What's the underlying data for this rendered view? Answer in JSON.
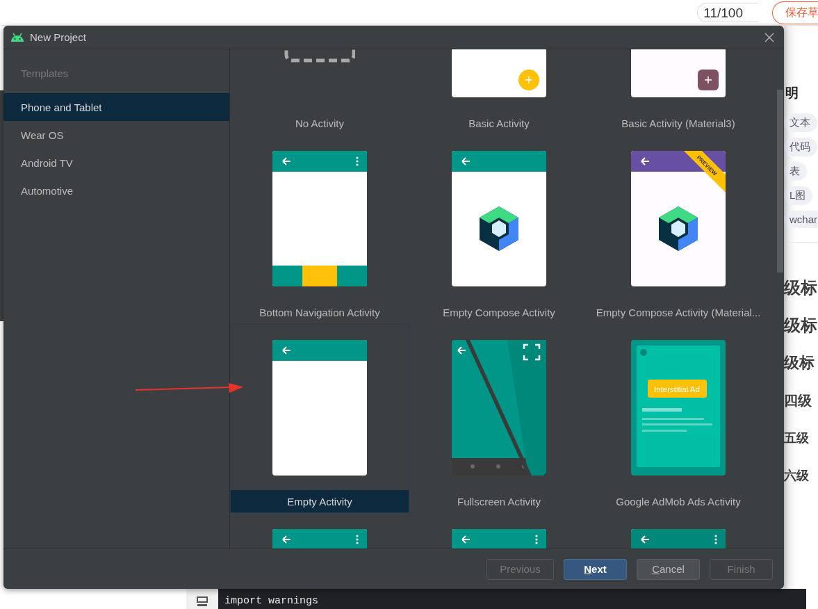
{
  "background_page": {
    "word_count": "11/100",
    "save_button": "保存草",
    "side_panel": {
      "heading": "明",
      "tags": [
        "文本",
        "代码",
        "表",
        "L图",
        "wchar"
      ],
      "headings": [
        "级标",
        "级标",
        "级标",
        "四级",
        "五级",
        "六级"
      ]
    },
    "code": "import warnings"
  },
  "window": {
    "title": "New Project"
  },
  "sidebar": {
    "header": "Templates",
    "items": [
      {
        "label": "Phone and Tablet",
        "selected": true
      },
      {
        "label": "Wear OS",
        "selected": false
      },
      {
        "label": "Android TV",
        "selected": false
      },
      {
        "label": "Automotive",
        "selected": false
      }
    ]
  },
  "templates": [
    {
      "kind": "no-activity",
      "name": "No Activity",
      "selected": false
    },
    {
      "kind": "basic",
      "name": "Basic Activity",
      "selected": false
    },
    {
      "kind": "basic-m3",
      "name": "Basic Activity (Material3)",
      "selected": false
    },
    {
      "kind": "bottom-nav",
      "name": "Bottom Navigation Activity",
      "selected": false
    },
    {
      "kind": "compose",
      "name": "Empty Compose Activity",
      "selected": false
    },
    {
      "kind": "compose-m3",
      "name": "Empty Compose Activity (Material...",
      "badge": "PREVIEW",
      "selected": false
    },
    {
      "kind": "empty",
      "name": "Empty Activity",
      "selected": true
    },
    {
      "kind": "fullscreen",
      "name": "Fullscreen Activity",
      "selected": false
    },
    {
      "kind": "admob",
      "name": "Google AdMob Ads Activity",
      "ad_label": "Interstitial Ad",
      "selected": false
    },
    {
      "kind": "menu-bar",
      "selected": false
    },
    {
      "kind": "menu-bar",
      "selected": false
    },
    {
      "kind": "menu-bar",
      "selected": false
    }
  ],
  "buttons": [
    {
      "label": "Previous",
      "kind": "normal",
      "disabled": true,
      "mnemonic": false
    },
    {
      "label": "Next",
      "kind": "default",
      "disabled": false,
      "mnemonic": true
    },
    {
      "label": "Cancel",
      "kind": "normal",
      "disabled": false,
      "mnemonic": true
    },
    {
      "label": "Finish",
      "kind": "normal",
      "disabled": true,
      "mnemonic": false
    }
  ]
}
